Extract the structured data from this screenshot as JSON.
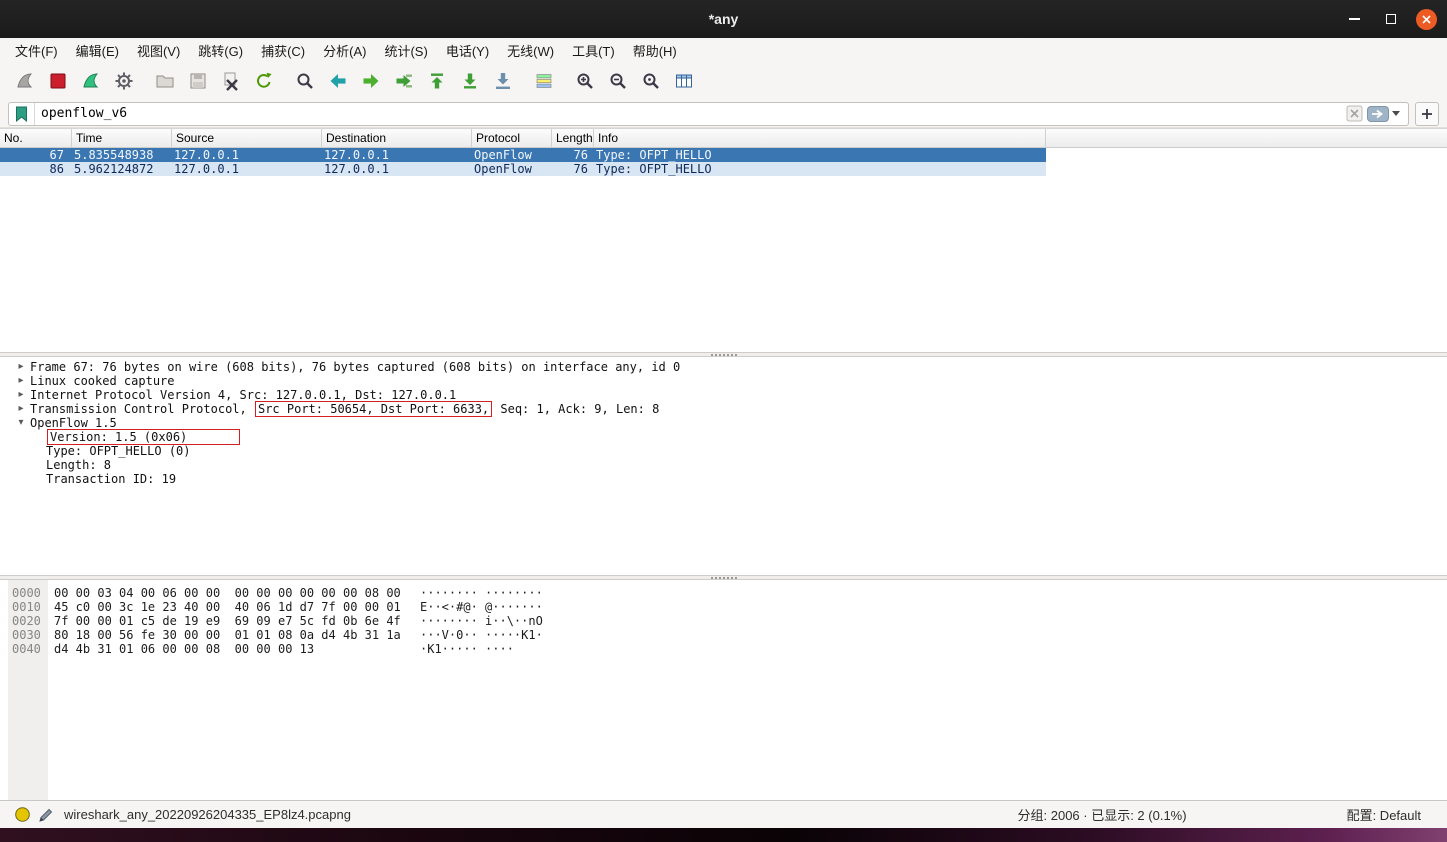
{
  "window": {
    "title": "*any"
  },
  "menu_bar": {
    "items": [
      "文件(F)",
      "编辑(E)",
      "视图(V)",
      "跳转(G)",
      "捕获(C)",
      "分析(A)",
      "统计(S)",
      "电话(Y)",
      "无线(W)",
      "工具(T)",
      "帮助(H)"
    ]
  },
  "toolbar": {
    "icons": [
      "start-capture",
      "stop-capture",
      "restart-capture",
      "capture-options",
      "open-file",
      "save-file",
      "close-file",
      "reload-file",
      "find-packet",
      "go-back",
      "go-forward",
      "go-to-packet",
      "go-first-packet",
      "go-last-packet",
      "auto-scroll",
      "colorize-packets",
      "zoom-in",
      "zoom-out",
      "zoom-original",
      "resize-columns"
    ]
  },
  "filter_bar": {
    "value": "openflow_v6"
  },
  "packet_list": {
    "columns": [
      "No.",
      "Time",
      "Source",
      "Destination",
      "Protocol",
      "Length",
      "Info"
    ],
    "rows": [
      {
        "no": "67",
        "time": "5.835548938",
        "source": "127.0.0.1",
        "destination": "127.0.0.1",
        "protocol": "OpenFlow",
        "length": "76",
        "info": "Type: OFPT_HELLO",
        "selected": true
      },
      {
        "no": "86",
        "time": "5.962124872",
        "source": "127.0.0.1",
        "destination": "127.0.0.1",
        "protocol": "OpenFlow",
        "length": "76",
        "info": "Type: OFPT_HELLO",
        "selected": false
      }
    ]
  },
  "packet_details": {
    "lines": [
      {
        "expander": "collapsed",
        "text": "Frame 67: 76 bytes on wire (608 bits), 76 bytes captured (608 bits) on interface any, id 0"
      },
      {
        "expander": "collapsed",
        "text": "Linux cooked capture"
      },
      {
        "expander": "collapsed",
        "text": "Internet Protocol Version 4, Src: 127.0.0.1, Dst: 127.0.0.1"
      },
      {
        "expander": "collapsed",
        "prefix": "Transmission Control Protocol, ",
        "boxed": "Src Port: 50654, Dst Port: 6633,",
        "suffix": " Seq: 1, Ack: 9, Len: 8"
      },
      {
        "expander": "expanded",
        "text": "OpenFlow 1.5"
      },
      {
        "expander": null,
        "boxed": "Version: 1.5 (0x06)"
      },
      {
        "expander": null,
        "text": "Type: OFPT_HELLO (0)"
      },
      {
        "expander": null,
        "text": "Length: 8"
      },
      {
        "expander": null,
        "text": "Transaction ID: 19"
      }
    ]
  },
  "hex_dump": {
    "rows": [
      {
        "offset": "0000",
        "hex": "00 00 03 04 00 06 00 00  00 00 00 00 00 00 08 00",
        "ascii": "········ ········"
      },
      {
        "offset": "0010",
        "hex": "45 c0 00 3c 1e 23 40 00  40 06 1d d7 7f 00 00 01",
        "ascii": "E··<·#@· @·······"
      },
      {
        "offset": "0020",
        "hex": "7f 00 00 01 c5 de 19 e9  69 09 e7 5c fd 0b 6e 4f",
        "ascii": "········ i··\\··nO"
      },
      {
        "offset": "0030",
        "hex": "80 18 00 56 fe 30 00 00  01 01 08 0a d4 4b 31 1a",
        "ascii": "···V·0·· ·····K1·"
      },
      {
        "offset": "0040",
        "hex": "d4 4b 31 01 06 00 00 08  00 00 00 13",
        "ascii": "·K1····· ····"
      }
    ]
  },
  "status_bar": {
    "filename": "wireshark_any_20220926204335_EP8lz4.pcapng",
    "stats": "分组: 2006 · 已显示: 2 (0.1%)",
    "profile": "配置:  Default"
  }
}
